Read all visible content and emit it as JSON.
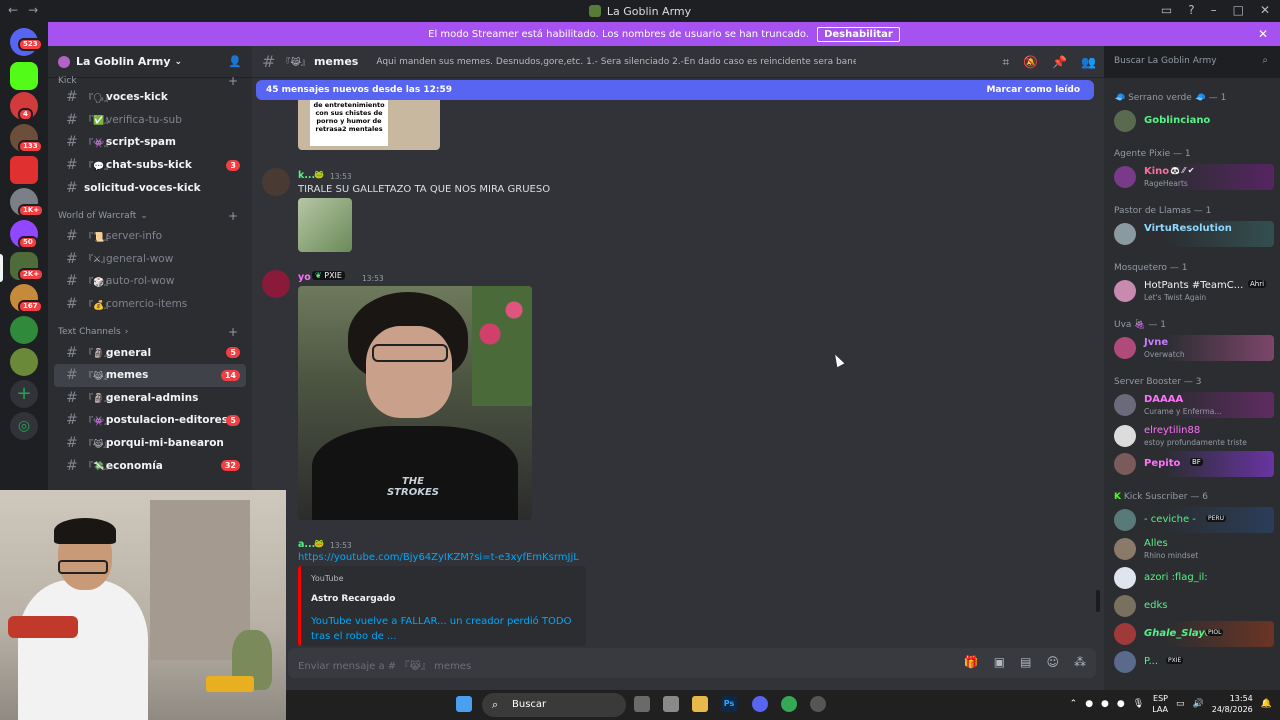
{
  "window": {
    "title": "La Goblin Army"
  },
  "banner": {
    "text": "El modo Streamer está habilitado. Los nombres de usuario se han truncado.",
    "button": "Deshabilitar"
  },
  "server_rail": {
    "badges": [
      "523",
      "4",
      "133",
      "1K+",
      "50",
      "2K+",
      "167"
    ]
  },
  "server": {
    "name": "La Goblin Army"
  },
  "sidebar": {
    "cat_kick": "Kick",
    "kick_channels": [
      {
        "emoji": "『🗣』",
        "name": "voces-kick",
        "badge": ""
      },
      {
        "emoji": "『✅』",
        "name": "verifica-tu-sub",
        "badge": ""
      },
      {
        "emoji": "『👾』",
        "name": "script-spam",
        "badge": ""
      },
      {
        "emoji": "『💬』",
        "name": "chat-subs-kick",
        "badge": "3"
      },
      {
        "emoji": "",
        "name": "solicitud-voces-kick",
        "badge": ""
      }
    ],
    "cat_wow": "World of Warcraft",
    "wow_channels": [
      {
        "emoji": "『📜』",
        "name": "server-info"
      },
      {
        "emoji": "『⚔』",
        "name": "general-wow"
      },
      {
        "emoji": "『🎲』",
        "name": "auto-rol-wow"
      },
      {
        "emoji": "『💰』",
        "name": "comercio-items"
      }
    ],
    "cat_text": "Text Channels",
    "text_channels": [
      {
        "emoji": "『🗿』",
        "name": "general",
        "badge": "5"
      },
      {
        "emoji": "『😹』",
        "name": "memes",
        "badge": "14"
      },
      {
        "emoji": "『🗿』",
        "name": "general-admins",
        "badge": ""
      },
      {
        "emoji": "『👾』",
        "name": "postulacion-editores",
        "badge": "5"
      },
      {
        "emoji": "『😹』",
        "name": "porqui-mi-banearon",
        "badge": ""
      },
      {
        "emoji": "『💸』",
        "name": "economía",
        "badge": "32"
      }
    ]
  },
  "channel": {
    "name": "memes",
    "emoji": "『😹』",
    "topic": "Aqui manden sus memes. Desnudos,gore,etc. 1.- Sera silenciado 2.-En dado caso es reincidente sera baneado"
  },
  "search": {
    "placeholder": "Buscar La Goblin Army"
  },
  "chat": {
    "new_messages": "45 mensajes nuevos desde las 12:59",
    "mark_read": "Marcar como leído",
    "meme_caption": "de entretenimiento con sus chistes de porno y humor de retrasa2 mentales",
    "messages": [
      {
        "author": "k...",
        "time": "13:53",
        "text": "TIRALE SU GALLETAZO TA QUE NOS MIRA GRUESO"
      },
      {
        "author": "yo",
        "tag": "PXIE",
        "time": "13:53"
      },
      {
        "author": "a...",
        "time": "13:53",
        "link": "https://youtube.com/Bjy64ZyIKZM?si=t-e3xyfEmKsrmJjL"
      }
    ],
    "embed": {
      "provider": "YouTube",
      "author": "Astro Recargado",
      "title": "YouTube vuelve a FALLAR... un creador perdió TODO tras el robo de ..."
    },
    "video_shirt_text": "THE STROKES"
  },
  "composer": {
    "placeholder": "Enviar mensaje a # 『😹』 memes"
  },
  "members": {
    "groups": [
      {
        "title": "🧢 Serrano verde 🧢 — 1",
        "members": [
          {
            "name": "Goblinciano",
            "status": "",
            "color": "#57f287"
          }
        ]
      },
      {
        "title": "Agente Pixie — 1",
        "members": [
          {
            "name": "Kino",
            "status": "RageHearts",
            "color": "#ff6b9d",
            "tag": "🐼 ⁄⁄ ✔"
          }
        ]
      },
      {
        "title": "Pastor de Llamas — 1",
        "members": [
          {
            "name": "VirtuResolution",
            "status": "",
            "color": "#8fd8ff"
          }
        ]
      },
      {
        "title": "Mosquetero — 1",
        "members": [
          {
            "name": "HotPants #TeamC...",
            "status": "Let's Twist Again",
            "color": "#f2f3f5",
            "tag": "Ahri"
          }
        ]
      },
      {
        "title": "Uva 🍇 — 1",
        "members": [
          {
            "name": "Jvne",
            "status": "Overwatch",
            "color": "#c77dff"
          }
        ]
      },
      {
        "title": "Server Booster — 3",
        "members": [
          {
            "name": "DAAAA",
            "status": "Curame y Enferma...",
            "color": "#ff73fa"
          },
          {
            "name": "elreytilin88",
            "status": "estoy profundamente triste",
            "color": "#ff73fa"
          },
          {
            "name": "Pepito",
            "status": "",
            "color": "#ff73fa",
            "tag": "BF"
          }
        ]
      },
      {
        "title": "Kick Suscriber — 6",
        "members": [
          {
            "name": "- ceviche -",
            "status": "",
            "color": "#57f287",
            "tag": "PERU"
          },
          {
            "name": "Alles",
            "status": "Rhino mindset",
            "color": "#57f287"
          },
          {
            "name": "azori :flag_il:",
            "status": "",
            "color": "#57f287"
          },
          {
            "name": "edks",
            "status": "",
            "color": "#57f287"
          },
          {
            "name": "Ghale_Slayer",
            "status": "",
            "color": "#57f287",
            "tag": "PIOL"
          },
          {
            "name": "P...",
            "status": "",
            "color": "#57f287",
            "tag": "PXIE"
          }
        ]
      }
    ]
  },
  "taskbar": {
    "search": "Buscar",
    "lang": "ESP",
    "lang2": "LAA",
    "time": "13:54",
    "date": "24/8/2026"
  }
}
